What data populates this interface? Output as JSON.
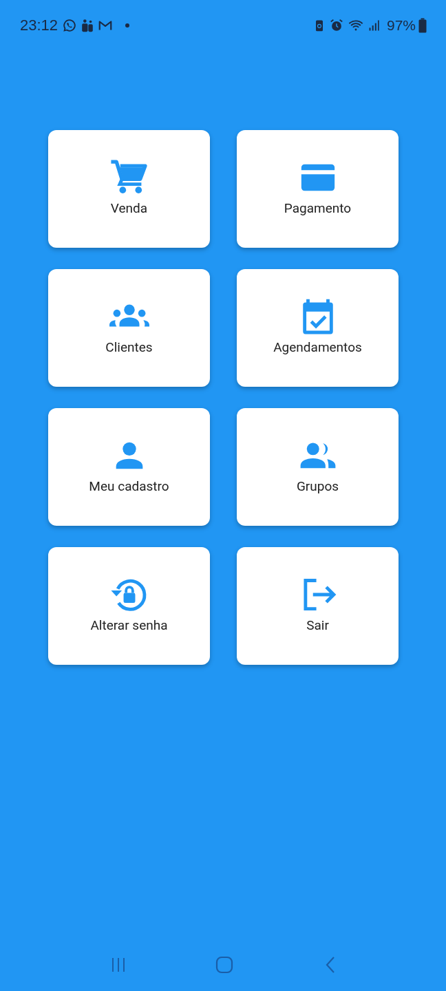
{
  "status_bar": {
    "time": "23:12",
    "battery": "97%"
  },
  "menu": [
    {
      "label": "Venda"
    },
    {
      "label": "Pagamento"
    },
    {
      "label": "Clientes"
    },
    {
      "label": "Agendamentos"
    },
    {
      "label": "Meu cadastro"
    },
    {
      "label": "Grupos"
    },
    {
      "label": "Alterar senha"
    },
    {
      "label": "Sair"
    }
  ]
}
